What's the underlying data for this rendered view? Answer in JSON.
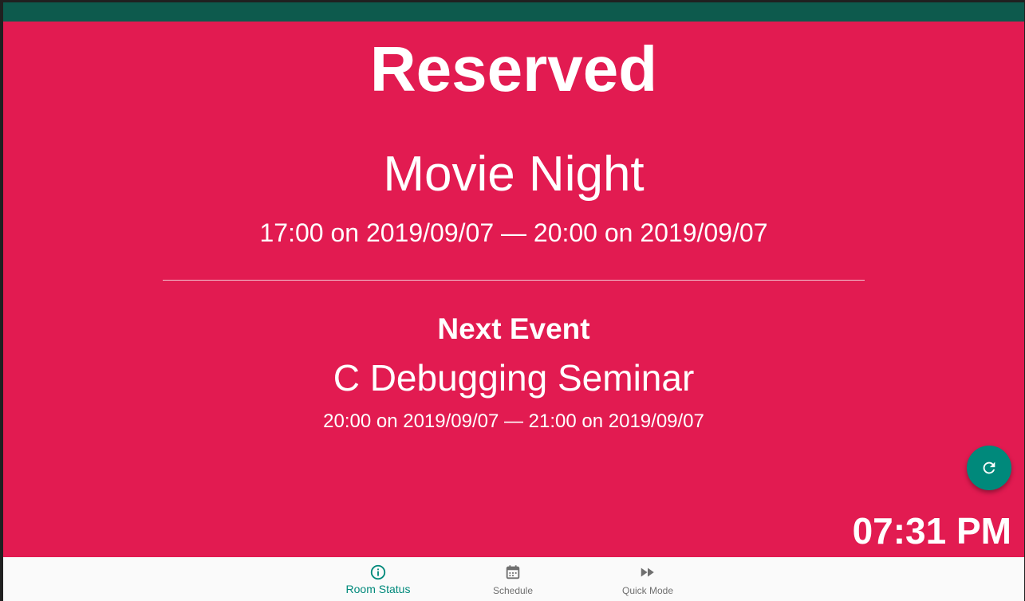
{
  "room": {
    "status": "Reserved",
    "status_color": "#e21b51"
  },
  "current_event": {
    "title": "Movie Night",
    "time": "17:00 on 2019/09/07 — 20:00 on 2019/09/07"
  },
  "next_event": {
    "label": "Next Event",
    "title": "C Debugging Seminar",
    "time": "20:00 on 2019/09/07 — 21:00 on 2019/09/07"
  },
  "clock": "07:31 PM",
  "refresh_button": {
    "icon": "refresh-icon",
    "color": "#00897b"
  },
  "bottom_nav": {
    "items": [
      {
        "label": "Room Status",
        "icon": "info-icon",
        "active": true
      },
      {
        "label": "Schedule",
        "icon": "calendar-icon",
        "active": false
      },
      {
        "label": "Quick Mode",
        "icon": "fast-forward-icon",
        "active": false
      }
    ],
    "active_color": "#00897b"
  },
  "status_bar": {
    "color": "#0d5a4d"
  }
}
